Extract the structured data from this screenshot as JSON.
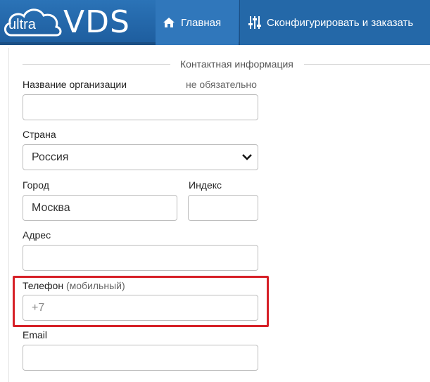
{
  "header": {
    "logo_small": "ultra",
    "logo_big": "VDS",
    "nav": [
      {
        "label": "Главная",
        "icon": "home-icon"
      },
      {
        "label": "Сконфигурировать и заказать",
        "icon": "sliders-icon"
      }
    ],
    "colors": {
      "brand": "#2468a8",
      "highlight": "#d62027"
    }
  },
  "form": {
    "section_title": "Контактная информация",
    "org_label": "Название организации",
    "org_optional": "не обязательно",
    "org_value": "",
    "country_label": "Страна",
    "country_value": "Россия",
    "city_label": "Город",
    "city_value": "Москва",
    "zip_label": "Индекс",
    "zip_value": "",
    "address_label": "Адрес",
    "address_value": "",
    "phone_label": "Телефон",
    "phone_label_note": "(мобильный)",
    "phone_placeholder": "+7",
    "email_label": "Email",
    "email_value": ""
  }
}
